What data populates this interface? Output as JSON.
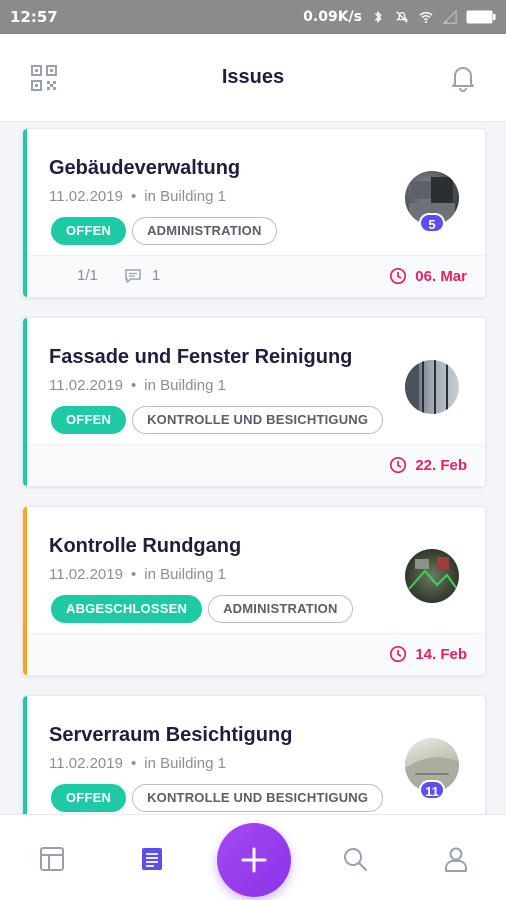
{
  "status_bar": {
    "time": "12:57",
    "net_speed": "0.09K/s",
    "icons": [
      "bluetooth-icon",
      "mute-icon",
      "wifi-icon",
      "signal-icon",
      "battery-icon"
    ]
  },
  "header": {
    "title": "Issues",
    "left_icon": "qr-code-icon",
    "right_icon": "bell-icon"
  },
  "issues": [
    {
      "title": "Gebäudeverwaltung",
      "date": "11.02.2019",
      "location": "in Building 1",
      "status": "OFFEN",
      "category": "ADMINISTRATION",
      "image_count": "5",
      "tasks": "1/1",
      "comments": "1",
      "due": "06. Mar",
      "accent_color": "#1ecaa3"
    },
    {
      "title": "Fassade und Fenster Reinigung",
      "date": "11.02.2019",
      "location": "in Building 1",
      "status": "OFFEN",
      "category": "KONTROLLE UND BESICHTIGUNG",
      "due": "22. Feb",
      "accent_color": "#1ecaa3"
    },
    {
      "title": "Kontrolle Rundgang",
      "date": "11.02.2019",
      "location": "in Building 1",
      "status": "ABGESCHLOSSEN",
      "category": "ADMINISTRATION",
      "due": "14. Feb",
      "accent_color": "#f5a623"
    },
    {
      "title": "Serverraum Besichtigung",
      "date": "11.02.2019",
      "location": "in Building 1",
      "status": "OFFEN",
      "category": "KONTROLLE UND BESICHTIGUNG",
      "image_count": "11",
      "accent_color": "#1ecaa3"
    }
  ],
  "bottom_nav": {
    "items": [
      "dashboard-icon",
      "issues-list-icon",
      "add-icon",
      "search-icon",
      "profile-icon"
    ],
    "active": "issues-list-icon",
    "active_color": "#5b4ff0"
  }
}
